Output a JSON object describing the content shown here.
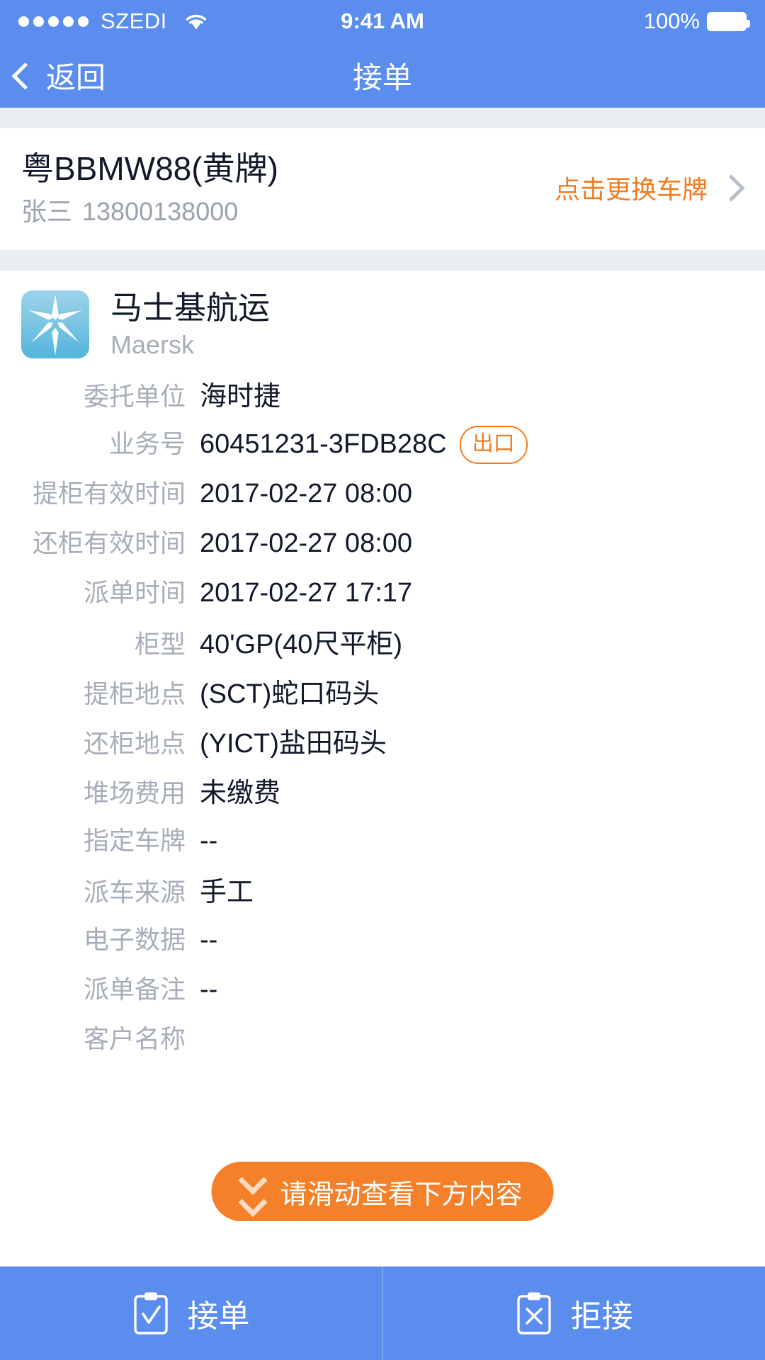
{
  "status_bar": {
    "carrier": "SZEDI",
    "signal_dots": 5,
    "wifi_icon": "wifi-icon",
    "time": "9:41 AM",
    "battery_percent": "100%",
    "battery_icon": "battery-full-icon"
  },
  "nav": {
    "back_icon": "chevron-left-icon",
    "back_label": "返回",
    "title": "接单"
  },
  "vehicle": {
    "plate": "粤BBMW88(黄牌)",
    "driver_name": "张三",
    "driver_phone": "13800138000",
    "change_plate_label": "点击更换车牌",
    "chevron_icon": "chevron-right-icon",
    "accent_color": "#f07c22"
  },
  "carrier_block": {
    "logo_icon": "maersk-star-logo",
    "logo_bg": "#54b4dc",
    "name_cn": "马士基航运",
    "name_en": "Maersk"
  },
  "details": {
    "rows": [
      {
        "label": "委托单位",
        "value": "海时捷"
      },
      {
        "label": "业务号",
        "value": "60451231-3FDB28C",
        "badge": "出口"
      },
      {
        "label": "提柜有效时间",
        "value": "2017-02-27 08:00"
      },
      {
        "label": "还柜有效时间",
        "value": "2017-02-27 08:00"
      },
      {
        "label": "派单时间",
        "value": "2017-02-27 17:17"
      },
      {
        "label": "柜型",
        "value": "40'GP(40尺平柜)"
      },
      {
        "label": "提柜地点",
        "value": "(SCT)蛇口码头"
      },
      {
        "label": "还柜地点",
        "value": "(YICT)盐田码头"
      },
      {
        "label": "堆场费用",
        "value": "未缴费"
      },
      {
        "label": "指定车牌",
        "value": "--"
      },
      {
        "label": "派车来源",
        "value": "手工"
      },
      {
        "label": "电子数据",
        "value": "--"
      },
      {
        "label": "派单备注",
        "value": "--"
      },
      {
        "label": "客户名称",
        "value": ""
      }
    ]
  },
  "scroll_hint": {
    "icon": "chevron-double-down-icon",
    "label": "请滑动查看下方内容",
    "background": "#f4812a"
  },
  "action_bar": {
    "buttons": [
      {
        "icon": "clipboard-check-icon",
        "label": "接单"
      },
      {
        "icon": "clipboard-x-icon",
        "label": "拒接"
      }
    ],
    "background": "#5b8def"
  }
}
